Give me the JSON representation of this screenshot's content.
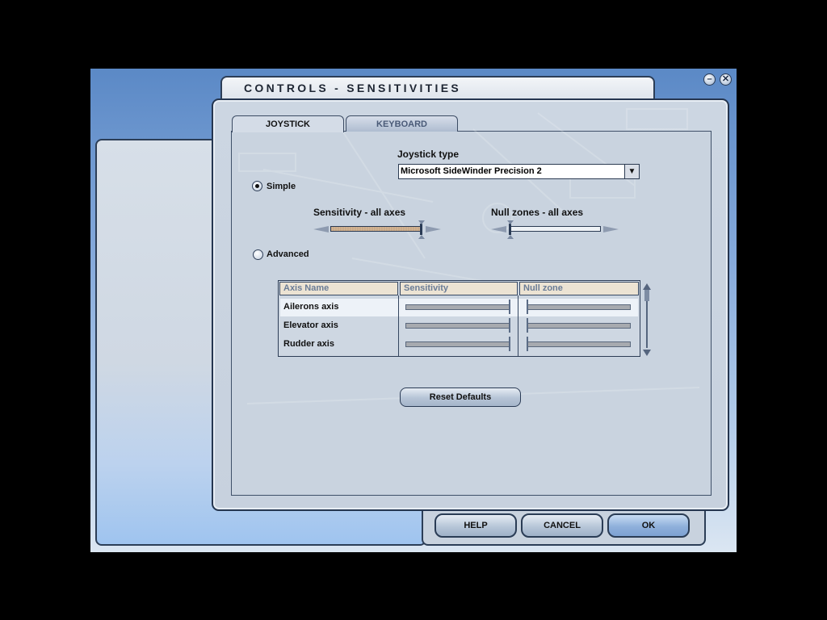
{
  "window": {
    "title": "CONTROLS - SENSITIVITIES",
    "minimize_icon": "minimize-icon",
    "close_icon": "close-icon"
  },
  "tabs": [
    {
      "label": "JOYSTICK",
      "active": true
    },
    {
      "label": "KEYBOARD",
      "active": false
    }
  ],
  "joystick": {
    "type_label": "Joystick type",
    "selected": "Microsoft SideWinder Precision 2"
  },
  "mode": {
    "simple_label": "Simple",
    "advanced_label": "Advanced",
    "selected": "Simple"
  },
  "simple": {
    "sensitivity_label": "Sensitivity - all axes",
    "sensitivity_level": 1.0,
    "null_label": "Null zones - all axes",
    "null_level": 0.0
  },
  "advanced_table": {
    "columns": [
      "Axis Name",
      "Sensitivity",
      "Null zone"
    ],
    "rows": [
      {
        "axis": "Ailerons axis",
        "sensitivity": 1.0,
        "null_zone": 0.0
      },
      {
        "axis": "Elevator axis",
        "sensitivity": 1.0,
        "null_zone": 0.0
      },
      {
        "axis": "Rudder axis",
        "sensitivity": 1.0,
        "null_zone": 0.0
      }
    ]
  },
  "buttons": {
    "reset": "Reset Defaults",
    "help": "HELP",
    "cancel": "CANCEL",
    "ok": "OK"
  },
  "colors": {
    "dialog_bg": "#c9d3df",
    "frame_border": "#2c3e57",
    "header_bg": "#ece3d3",
    "slider_fill": "#c7a786"
  }
}
